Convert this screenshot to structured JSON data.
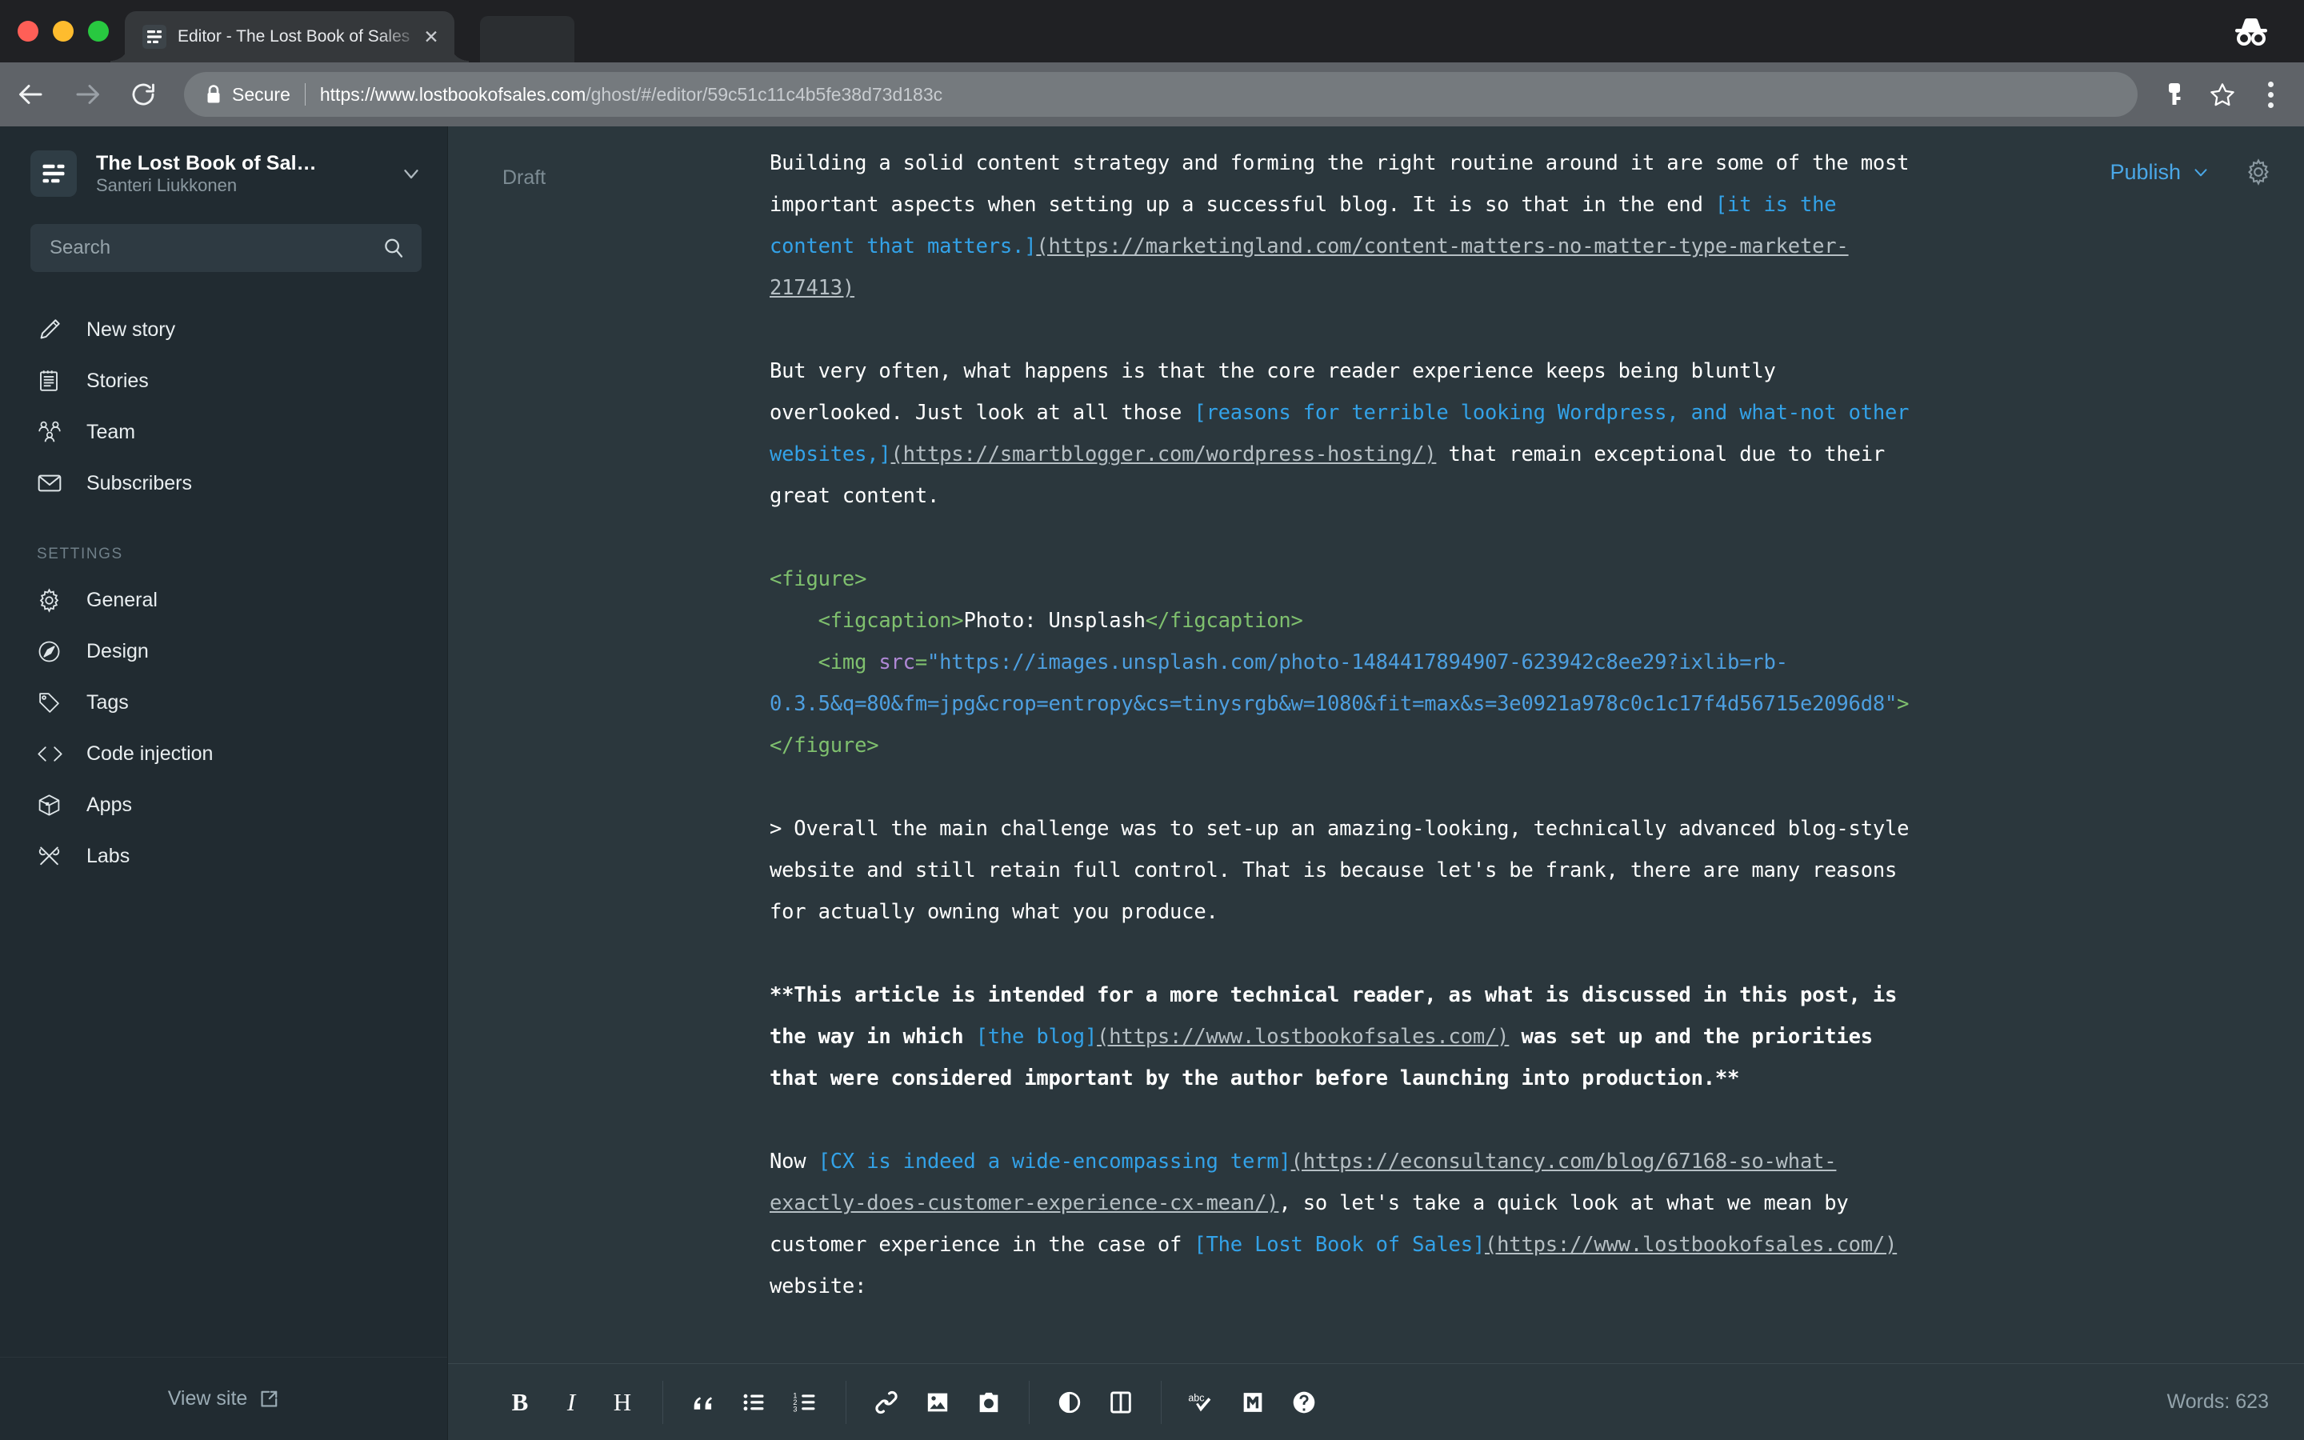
{
  "browser": {
    "tab": {
      "title": "Editor - The Lost Book of Sales",
      "favicon_icon": "ghost-logo-icon",
      "close_icon": "close-icon"
    },
    "window_controls": [
      "close",
      "minimize",
      "maximize"
    ],
    "incognito_icon": "incognito-icon",
    "nav": {
      "back_icon": "back-arrow-icon",
      "forward_icon": "forward-arrow-icon",
      "reload_icon": "reload-icon"
    },
    "omnibox": {
      "lock_icon": "lock-icon",
      "security_label": "Secure",
      "url_host": "https://www.lostbookofsales.com",
      "url_path": "/ghost/#/editor/59c51c11c4b5fe38d73d183c",
      "url_full": "https://www.lostbookofsales.com/ghost/#/editor/59c51c11c4b5fe38d73d183c",
      "key_icon": "key-icon",
      "bookmark_icon": "star-icon",
      "menu_icon": "kebab-menu-icon"
    }
  },
  "sidebar": {
    "blog": {
      "title": "The Lost Book of Sal…",
      "author": "Santeri Liukkonen",
      "logo_icon": "ghost-logo-icon",
      "caret_icon": "chevron-down-icon"
    },
    "search": {
      "placeholder": "Search",
      "value": "",
      "icon": "search-icon"
    },
    "items": [
      {
        "label": "New story",
        "icon": "pencil-icon"
      },
      {
        "label": "Stories",
        "icon": "notebook-icon"
      },
      {
        "label": "Team",
        "icon": "team-icon"
      },
      {
        "label": "Subscribers",
        "icon": "envelope-icon"
      }
    ],
    "section_label": "SETTINGS",
    "settings_items": [
      {
        "label": "General",
        "icon": "gear-icon"
      },
      {
        "label": "Design",
        "icon": "compass-icon"
      },
      {
        "label": "Tags",
        "icon": "tag-icon"
      },
      {
        "label": "Code injection",
        "icon": "code-brackets-icon"
      },
      {
        "label": "Apps",
        "icon": "box-icon"
      },
      {
        "label": "Labs",
        "icon": "tools-icon"
      }
    ],
    "footer": {
      "label": "View site",
      "icon": "external-link-icon"
    }
  },
  "editor": {
    "status": "Draft",
    "publish_label": "Publish",
    "publish_caret_icon": "chevron-down-icon",
    "settings_icon": "gear-icon",
    "word_count": "Words: 623",
    "colors": {
      "editor_bg": "#2b373d",
      "sidebar_bg": "#212b31",
      "link_text": "#33a2e8",
      "link_url": "#b6bfc4",
      "html_tag": "#7fc06e",
      "html_attr": "#b088d6",
      "html_string": "#4d9fe0",
      "publish_accent": "#4aa8e8"
    },
    "toolbar": [
      {
        "icon": "bold-icon",
        "label": "B"
      },
      {
        "icon": "italic-icon",
        "label": "I"
      },
      {
        "icon": "heading-icon",
        "label": "H"
      },
      {
        "icon": "blockquote-icon",
        "label": ""
      },
      {
        "icon": "bullet-list-icon",
        "label": ""
      },
      {
        "icon": "numbered-list-icon",
        "label": ""
      },
      {
        "icon": "link-icon",
        "label": ""
      },
      {
        "icon": "image-icon",
        "label": ""
      },
      {
        "icon": "camera-icon",
        "label": ""
      },
      {
        "icon": "preview-eye-icon",
        "label": ""
      },
      {
        "icon": "split-view-icon",
        "label": ""
      },
      {
        "icon": "spellcheck-icon",
        "label": ""
      },
      {
        "icon": "markdown-icon",
        "label": ""
      },
      {
        "icon": "help-icon",
        "label": ""
      }
    ],
    "document": [
      {
        "type": "paragraph",
        "parts": [
          {
            "t": "Building a solid content strategy and forming the right routine around it are some of the most important aspects when setting up a successful blog. It is so that in the end ",
            "c": "plain"
          },
          {
            "t": "[it is the content that matters.]",
            "c": "linktext"
          },
          {
            "t": "(https://marketingland.com/content-matters-no-matter-type-marketer-217413)",
            "c": "url"
          }
        ]
      },
      {
        "type": "blank"
      },
      {
        "type": "paragraph",
        "parts": [
          {
            "t": "But very often, what happens is that the core reader experience keeps being bluntly overlooked. Just look at all those ",
            "c": "plain"
          },
          {
            "t": "[reasons for terrible looking Wordpress, and what-not other websites,]",
            "c": "linktext"
          },
          {
            "t": "(https://smartblogger.com/wordpress-hosting/)",
            "c": "url"
          },
          {
            "t": " that remain exceptional due to their great content.",
            "c": "plain"
          }
        ]
      },
      {
        "type": "blank"
      },
      {
        "type": "html",
        "parts": [
          {
            "t": "<figure>",
            "c": "tag"
          }
        ]
      },
      {
        "type": "html",
        "parts": [
          {
            "t": "    ",
            "c": "plain"
          },
          {
            "t": "<figcaption>",
            "c": "tag"
          },
          {
            "t": "Photo: Unsplash",
            "c": "plain"
          },
          {
            "t": "</figcaption>",
            "c": "tag"
          }
        ]
      },
      {
        "type": "html",
        "parts": [
          {
            "t": "    ",
            "c": "plain"
          },
          {
            "t": "<img ",
            "c": "tag"
          },
          {
            "t": "src",
            "c": "attr"
          },
          {
            "t": "=",
            "c": "tag"
          },
          {
            "t": "\"https://images.unsplash.com/photo-1484417894907-623942c8ee29?ixlib=rb-0.3.5&q=80&fm=jpg&crop=entropy&cs=tinysrgb&w=1080&fit=max&s=3e0921a978c0c1c17f4d56715e2096d8\"",
            "c": "string"
          },
          {
            "t": ">",
            "c": "tag"
          }
        ]
      },
      {
        "type": "html",
        "parts": [
          {
            "t": "</figure>",
            "c": "tag"
          }
        ]
      },
      {
        "type": "blank"
      },
      {
        "type": "blockquote",
        "parts": [
          {
            "t": "> Overall the main challenge was to set-up an amazing-looking, technically advanced blog-style website and still retain full control. That is because let's be frank, there are many reasons for actually owning what you produce.",
            "c": "plain"
          }
        ]
      },
      {
        "type": "blank"
      },
      {
        "type": "paragraph",
        "parts": [
          {
            "t": "**This article is intended for a more technical reader, as what is discussed in this post, is the way in which ",
            "c": "bold"
          },
          {
            "t": "[the blog]",
            "c": "linktext"
          },
          {
            "t": "(https://www.lostbookofsales.com/)",
            "c": "url"
          },
          {
            "t": " was set up and the priorities that were considered important by the author before launching into production.**",
            "c": "bold"
          }
        ]
      },
      {
        "type": "blank"
      },
      {
        "type": "paragraph",
        "parts": [
          {
            "t": "Now ",
            "c": "plain"
          },
          {
            "t": "[CX is indeed a wide-encompassing term]",
            "c": "linktext"
          },
          {
            "t": "(https://econsultancy.com/blog/67168-so-what-exactly-does-customer-experience-cx-mean/)",
            "c": "url"
          },
          {
            "t": ", so let's take a quick look at what we mean by customer experience in the case of ",
            "c": "plain"
          },
          {
            "t": "[The Lost Book of Sales]",
            "c": "linktext"
          },
          {
            "t": "(https://www.lostbookofsales.com/)",
            "c": "url"
          },
          {
            "t": " website:",
            "c": "plain"
          }
        ]
      }
    ]
  }
}
